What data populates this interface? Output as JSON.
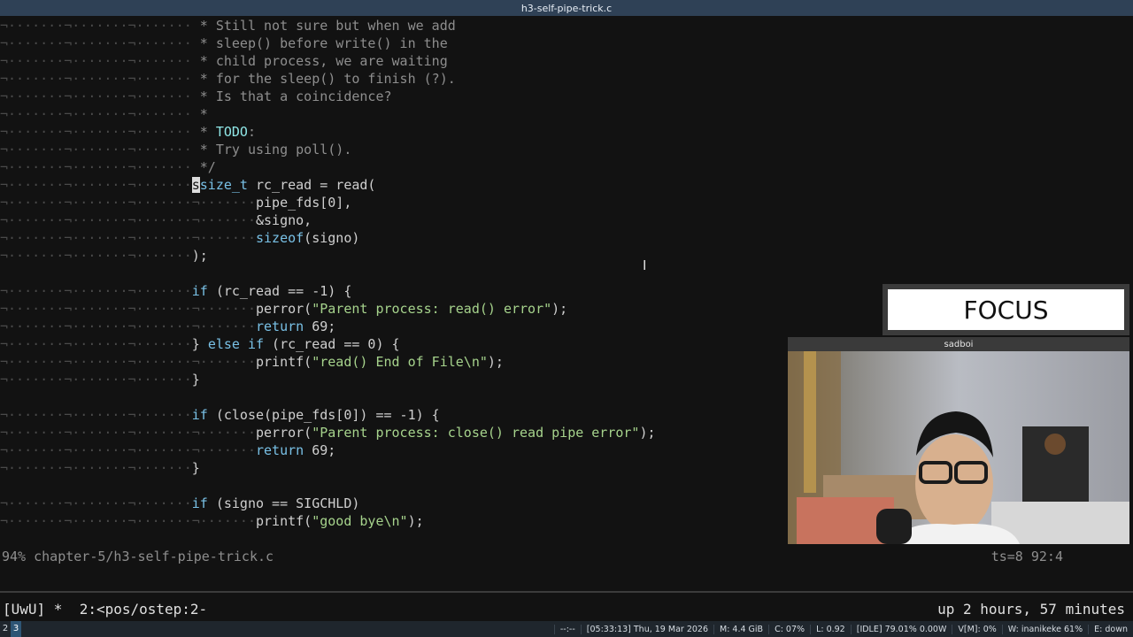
{
  "window_title": "h3-self-pipe-trick.c",
  "editor": {
    "lines": [
      [
        [
          "ind",
          "¬·······¬·······¬······· "
        ],
        [
          "cmt",
          "* Still not sure but when we add"
        ]
      ],
      [
        [
          "ind",
          "¬·······¬·······¬······· "
        ],
        [
          "cmt",
          "* sleep() before write() in the"
        ]
      ],
      [
        [
          "ind",
          "¬·······¬·······¬······· "
        ],
        [
          "cmt",
          "* child process, we are waiting"
        ]
      ],
      [
        [
          "ind",
          "¬·······¬·······¬······· "
        ],
        [
          "cmt",
          "* for the sleep() to finish (?)."
        ]
      ],
      [
        [
          "ind",
          "¬·······¬·······¬······· "
        ],
        [
          "cmt",
          "* Is that a coincidence?"
        ]
      ],
      [
        [
          "ind",
          "¬·······¬·······¬······· "
        ],
        [
          "cmt",
          "*"
        ]
      ],
      [
        [
          "ind",
          "¬·······¬·······¬······· "
        ],
        [
          "cmt",
          "* "
        ],
        [
          "todo",
          "TODO"
        ],
        [
          "cmt",
          ":"
        ]
      ],
      [
        [
          "ind",
          "¬·······¬·······¬······· "
        ],
        [
          "cmt",
          "* Try using poll()."
        ]
      ],
      [
        [
          "ind",
          "¬·······¬·······¬······· "
        ],
        [
          "cmt",
          "*/"
        ]
      ],
      [
        [
          "ind",
          "¬·······¬·······¬·······"
        ],
        [
          "cursor",
          "s"
        ],
        [
          "kw",
          "size_t"
        ],
        [
          "pl",
          " rc_read = read("
        ]
      ],
      [
        [
          "ind",
          "¬·······¬·······¬·······¬·······"
        ],
        [
          "pl",
          "pipe_fds[0],"
        ]
      ],
      [
        [
          "ind",
          "¬·······¬·······¬·······¬·······"
        ],
        [
          "pl",
          "&signo,"
        ]
      ],
      [
        [
          "ind",
          "¬·······¬·······¬·······¬·······"
        ],
        [
          "kw",
          "sizeof"
        ],
        [
          "pl",
          "(signo)"
        ]
      ],
      [
        [
          "ind",
          "¬·······¬·······¬·······"
        ],
        [
          "pl",
          ");"
        ]
      ],
      [],
      [
        [
          "ind",
          "¬·······¬·······¬·······"
        ],
        [
          "kw",
          "if"
        ],
        [
          "pl",
          " (rc_read == -1) {"
        ]
      ],
      [
        [
          "ind",
          "¬·······¬·······¬·······¬·······"
        ],
        [
          "pl",
          "perror("
        ],
        [
          "str",
          "\"Parent process: read() error\""
        ],
        [
          "pl",
          ");"
        ]
      ],
      [
        [
          "ind",
          "¬·······¬·······¬·······¬·······"
        ],
        [
          "kw",
          "return"
        ],
        [
          "pl",
          " 69;"
        ]
      ],
      [
        [
          "ind",
          "¬·······¬·······¬·······"
        ],
        [
          "pl",
          "} "
        ],
        [
          "kw",
          "else if"
        ],
        [
          "pl",
          " (rc_read == 0) {"
        ]
      ],
      [
        [
          "ind",
          "¬·······¬·······¬·······¬·······"
        ],
        [
          "pl",
          "printf("
        ],
        [
          "str",
          "\"read() End of File\\n\""
        ],
        [
          "pl",
          ");"
        ]
      ],
      [
        [
          "ind",
          "¬·······¬·······¬·······"
        ],
        [
          "pl",
          "}"
        ]
      ],
      [],
      [
        [
          "ind",
          "¬·······¬·······¬·······"
        ],
        [
          "kw",
          "if"
        ],
        [
          "pl",
          " (close(pipe_fds[0]) == -1) {"
        ]
      ],
      [
        [
          "ind",
          "¬·······¬·······¬·······¬·······"
        ],
        [
          "pl",
          "perror("
        ],
        [
          "str",
          "\"Parent process: close() read pipe error\""
        ],
        [
          "pl",
          ");"
        ]
      ],
      [
        [
          "ind",
          "¬·······¬·······¬·······¬·······"
        ],
        [
          "kw",
          "return"
        ],
        [
          "pl",
          " 69;"
        ]
      ],
      [
        [
          "ind",
          "¬·······¬·······¬·······"
        ],
        [
          "pl",
          "}"
        ]
      ],
      [],
      [
        [
          "ind",
          "¬·······¬·······¬·······"
        ],
        [
          "kw",
          "if"
        ],
        [
          "pl",
          " (signo == SIGCHLD)"
        ]
      ],
      [
        [
          "ind",
          "¬·······¬·······¬·······¬·······"
        ],
        [
          "pl",
          "printf("
        ],
        [
          "str",
          "\"good bye\\n\""
        ],
        [
          "pl",
          ");"
        ]
      ]
    ]
  },
  "statusline": {
    "file_info": "94% chapter-5/h3-self-pipe-trick.c",
    "position": "ts=8 92:4"
  },
  "focus_label": "FOCUS",
  "webcam": {
    "name": "sadboi"
  },
  "tmux": {
    "session": "[UwU] *  2:<pos/ostep:2-",
    "uptime": "up 2 hours, 57 minutes"
  },
  "bottombar": {
    "workspaces": [
      "2",
      "3"
    ],
    "active_workspace": "3",
    "items": [
      "--:--",
      "[05:33:13] Thu, 19 Mar 2026",
      "M: 4.4 GiB",
      "C: 07%",
      "L: 0.92",
      "[IDLE] 79.01% 0.00W",
      "V[M]: 0%",
      "W: inanikeke 61%",
      "E: down"
    ]
  }
}
